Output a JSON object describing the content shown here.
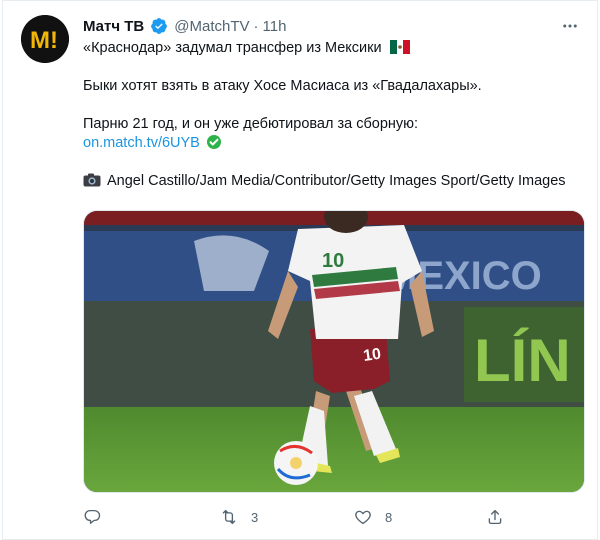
{
  "author": {
    "avatar_text": "M!",
    "name": "Матч ТВ",
    "handle": "@MatchTV",
    "dot": "·",
    "time": "11h"
  },
  "tweet": {
    "line1": "«Краснодар» задумал трансфер из Мексики",
    "line2": "Быки хотят взять в атаку Хосе Масиаса из  «Гвадалахары».",
    "line3": "Парню 21 год, и он уже дебютировал за сборную:",
    "link": "on.match.tv/6UYB",
    "credit": "Angel Castillo/Jam Media/Contributor/Getty Images Sport/Getty Images"
  },
  "media": {
    "jersey_number": "10",
    "board_text": "MEXICO",
    "board_text2": "LÍN"
  },
  "actions": {
    "retweets": "3",
    "likes": "8"
  },
  "icons": {
    "verified": "verified-badge-icon",
    "more": "more-dots-icon",
    "flag": "mexico-flag-icon",
    "link_check": "check-circle-icon",
    "camera": "camera-icon",
    "reply": "reply-icon",
    "retweet": "retweet-icon",
    "like": "heart-icon",
    "share": "share-icon"
  },
  "colors": {
    "link": "#1b95e0",
    "verified": "#1d9bf0",
    "muted": "#536471",
    "avatar_bg": "#111111",
    "avatar_fg": "#f2b705"
  }
}
